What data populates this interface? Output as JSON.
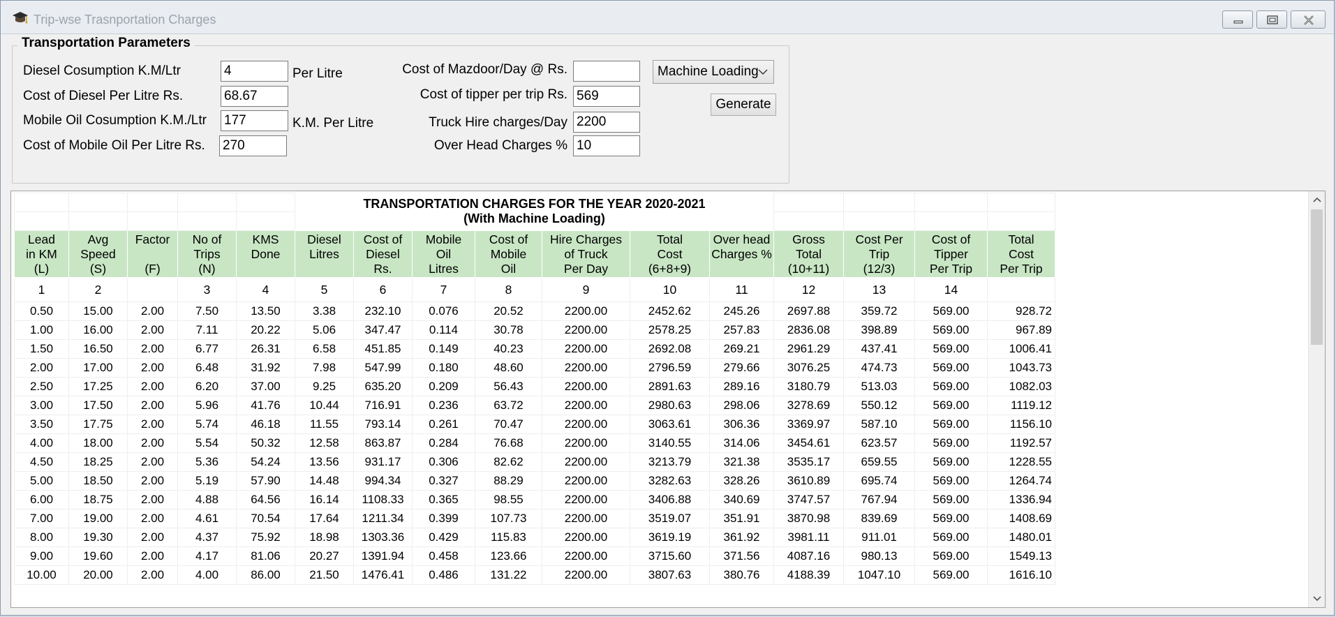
{
  "window": {
    "title": "Trip-wse Trasnportation Charges"
  },
  "params": {
    "legend": "Transportation Parameters",
    "diesel_consumption": {
      "label": "Diesel Cosumption K.M/Ltr",
      "value": "4",
      "unit": "Per Litre"
    },
    "diesel_cost": {
      "label": "Cost of Diesel Per Litre Rs.",
      "value": "68.67"
    },
    "mobile_oil_consumption": {
      "label": "Mobile Oil Cosumption K.M./Ltr",
      "value": "177",
      "unit": "K.M. Per Litre"
    },
    "mobile_oil_cost": {
      "label": "Cost of Mobile Oil Per Litre Rs.",
      "value": "270"
    },
    "mazdoor_cost": {
      "label": "Cost of Mazdoor/Day @ Rs.",
      "value": ""
    },
    "tipper_cost": {
      "label": "Cost of tipper per trip Rs.",
      "value": "569"
    },
    "truck_hire": {
      "label": "Truck Hire charges/Day",
      "value": "2200"
    },
    "overhead": {
      "label": "Over Head Charges %",
      "value": "10"
    },
    "loading_select": "Machine Loading",
    "generate_label": "Generate"
  },
  "report": {
    "title_line1": "TRANSPORTATION CHARGES FOR THE YEAR 2020-2021",
    "title_line2": "(With Machine Loading)",
    "header_color": "#c8e6c4",
    "columns": [
      [
        "Lead",
        "in KM",
        "(L)"
      ],
      [
        "Avg",
        "Speed",
        "(S)"
      ],
      [
        "Factor",
        "",
        "(F)"
      ],
      [
        "No of",
        "Trips",
        "(N)"
      ],
      [
        "KMS",
        "Done",
        ""
      ],
      [
        "Diesel",
        "Litres",
        ""
      ],
      [
        "Cost of",
        "Diesel",
        "Rs."
      ],
      [
        "Mobile",
        "Oil",
        "Litres"
      ],
      [
        "Cost of",
        "Mobile",
        "Oil"
      ],
      [
        "Hire Charges",
        "of Truck",
        "Per Day"
      ],
      [
        "Total",
        "Cost",
        "(6+8+9)"
      ],
      [
        "Over head",
        "Charges %",
        ""
      ],
      [
        "Gross",
        "Total",
        "(10+11)"
      ],
      [
        "Cost Per",
        "Trip",
        "(12/3)"
      ],
      [
        "Cost of",
        "Tipper",
        "Per Trip"
      ],
      [
        "Total",
        "Cost",
        "Per Trip"
      ]
    ],
    "column_numbers": [
      "1",
      "2",
      "",
      "3",
      "4",
      "5",
      "6",
      "7",
      "8",
      "9",
      "10",
      "11",
      "12",
      "13",
      "14",
      ""
    ],
    "rows": [
      [
        "0.50",
        "15.00",
        "2.00",
        "7.50",
        "13.50",
        "3.38",
        "232.10",
        "0.076",
        "20.52",
        "2200.00",
        "2452.62",
        "245.26",
        "2697.88",
        "359.72",
        "569.00",
        "928.72"
      ],
      [
        "1.00",
        "16.00",
        "2.00",
        "7.11",
        "20.22",
        "5.06",
        "347.47",
        "0.114",
        "30.78",
        "2200.00",
        "2578.25",
        "257.83",
        "2836.08",
        "398.89",
        "569.00",
        "967.89"
      ],
      [
        "1.50",
        "16.50",
        "2.00",
        "6.77",
        "26.31",
        "6.58",
        "451.85",
        "0.149",
        "40.23",
        "2200.00",
        "2692.08",
        "269.21",
        "2961.29",
        "437.41",
        "569.00",
        "1006.41"
      ],
      [
        "2.00",
        "17.00",
        "2.00",
        "6.48",
        "31.92",
        "7.98",
        "547.99",
        "0.180",
        "48.60",
        "2200.00",
        "2796.59",
        "279.66",
        "3076.25",
        "474.73",
        "569.00",
        "1043.73"
      ],
      [
        "2.50",
        "17.25",
        "2.00",
        "6.20",
        "37.00",
        "9.25",
        "635.20",
        "0.209",
        "56.43",
        "2200.00",
        "2891.63",
        "289.16",
        "3180.79",
        "513.03",
        "569.00",
        "1082.03"
      ],
      [
        "3.00",
        "17.50",
        "2.00",
        "5.96",
        "41.76",
        "10.44",
        "716.91",
        "0.236",
        "63.72",
        "2200.00",
        "2980.63",
        "298.06",
        "3278.69",
        "550.12",
        "569.00",
        "1119.12"
      ],
      [
        "3.50",
        "17.75",
        "2.00",
        "5.74",
        "46.18",
        "11.55",
        "793.14",
        "0.261",
        "70.47",
        "2200.00",
        "3063.61",
        "306.36",
        "3369.97",
        "587.10",
        "569.00",
        "1156.10"
      ],
      [
        "4.00",
        "18.00",
        "2.00",
        "5.54",
        "50.32",
        "12.58",
        "863.87",
        "0.284",
        "76.68",
        "2200.00",
        "3140.55",
        "314.06",
        "3454.61",
        "623.57",
        "569.00",
        "1192.57"
      ],
      [
        "4.50",
        "18.25",
        "2.00",
        "5.36",
        "54.24",
        "13.56",
        "931.17",
        "0.306",
        "82.62",
        "2200.00",
        "3213.79",
        "321.38",
        "3535.17",
        "659.55",
        "569.00",
        "1228.55"
      ],
      [
        "5.00",
        "18.50",
        "2.00",
        "5.19",
        "57.90",
        "14.48",
        "994.34",
        "0.327",
        "88.29",
        "2200.00",
        "3282.63",
        "328.26",
        "3610.89",
        "695.74",
        "569.00",
        "1264.74"
      ],
      [
        "6.00",
        "18.75",
        "2.00",
        "4.88",
        "64.56",
        "16.14",
        "1108.33",
        "0.365",
        "98.55",
        "2200.00",
        "3406.88",
        "340.69",
        "3747.57",
        "767.94",
        "569.00",
        "1336.94"
      ],
      [
        "7.00",
        "19.00",
        "2.00",
        "4.61",
        "70.54",
        "17.64",
        "1211.34",
        "0.399",
        "107.73",
        "2200.00",
        "3519.07",
        "351.91",
        "3870.98",
        "839.69",
        "569.00",
        "1408.69"
      ],
      [
        "8.00",
        "19.30",
        "2.00",
        "4.37",
        "75.92",
        "18.98",
        "1303.36",
        "0.429",
        "115.83",
        "2200.00",
        "3619.19",
        "361.92",
        "3981.11",
        "911.01",
        "569.00",
        "1480.01"
      ],
      [
        "9.00",
        "19.60",
        "2.00",
        "4.17",
        "81.06",
        "20.27",
        "1391.94",
        "0.458",
        "123.66",
        "2200.00",
        "3715.60",
        "371.56",
        "4087.16",
        "980.13",
        "569.00",
        "1549.13"
      ],
      [
        "10.00",
        "20.00",
        "2.00",
        "4.00",
        "86.00",
        "21.50",
        "1476.41",
        "0.486",
        "131.22",
        "2200.00",
        "3807.63",
        "380.76",
        "4188.39",
        "1047.10",
        "569.00",
        "1616.10"
      ]
    ]
  }
}
